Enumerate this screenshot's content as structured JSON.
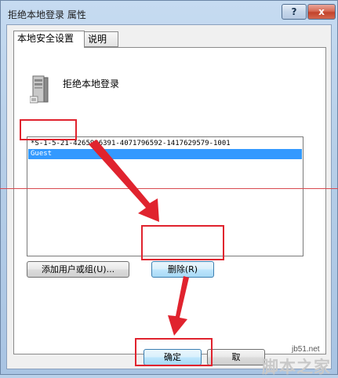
{
  "window": {
    "title": "拒绝本地登录 属性",
    "help_label": "?",
    "close_label": "x"
  },
  "tabs": [
    {
      "label": "本地安全设置"
    },
    {
      "label": "说明"
    }
  ],
  "policy": {
    "name": "拒绝本地登录",
    "icon": "server-icon"
  },
  "list": {
    "items": [
      {
        "label": "*S-1-5-21-4265936391-4071796592-1417629579-1001",
        "selected": false
      },
      {
        "label": "Guest",
        "selected": true
      }
    ]
  },
  "buttons": {
    "add": "添加用户或组(U)...",
    "remove": "删除(R)",
    "ok": "确定",
    "cancel": "取"
  },
  "watermark": {
    "url": "jb51.net",
    "text": "脚本之家"
  },
  "colors": {
    "highlight": "#e0232e",
    "selection": "#3399ff"
  }
}
